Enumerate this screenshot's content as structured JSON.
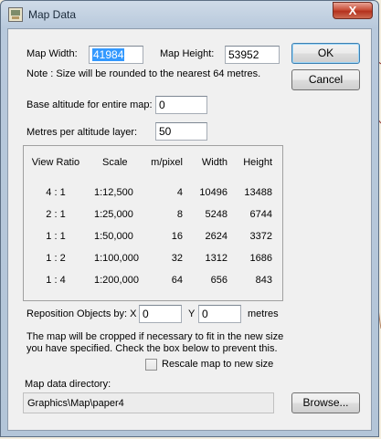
{
  "window": {
    "title": "Map Data",
    "close_glyph": "X"
  },
  "map_width": {
    "label": "Map Width:",
    "value": "41984"
  },
  "map_height": {
    "label": "Map Height:",
    "value": "53952"
  },
  "note": "Note : Size will be rounded to the nearest 64 metres.",
  "base_altitude": {
    "label": "Base altitude for entire map:",
    "value": "0"
  },
  "metres_per_layer": {
    "label": "Metres per altitude layer:",
    "value": "50"
  },
  "buttons": {
    "ok": "OK",
    "cancel": "Cancel",
    "browse": "Browse..."
  },
  "ratio_table": {
    "headers": [
      "View Ratio",
      "Scale",
      "m/pixel",
      "Width",
      "Height"
    ],
    "rows": [
      [
        "4 : 1",
        "1:12,500",
        "4",
        "10496",
        "13488"
      ],
      [
        "2 : 1",
        "1:25,000",
        "8",
        "5248",
        "6744"
      ],
      [
        "1 : 1",
        "1:50,000",
        "16",
        "2624",
        "3372"
      ],
      [
        "1 : 2",
        "1:100,000",
        "32",
        "1312",
        "1686"
      ],
      [
        "1 : 4",
        "1:200,000",
        "64",
        "656",
        "843"
      ]
    ]
  },
  "reposition": {
    "label": "Reposition Objects by: X",
    "x_value": "0",
    "y_label": "Y",
    "y_value": "0",
    "unit": "metres"
  },
  "crop_note": {
    "line1": "The map will be cropped if necessary to fit in the new size",
    "line2": "you have specified.  Check the box below to prevent this."
  },
  "rescale_checkbox": {
    "label": "Rescale map to new size",
    "checked": false
  },
  "map_dir": {
    "label": "Map data directory:",
    "value": "Graphics\\Map\\paper4"
  },
  "icons": {
    "title_icon": "map-app-icon",
    "close_icon": "close-icon"
  }
}
